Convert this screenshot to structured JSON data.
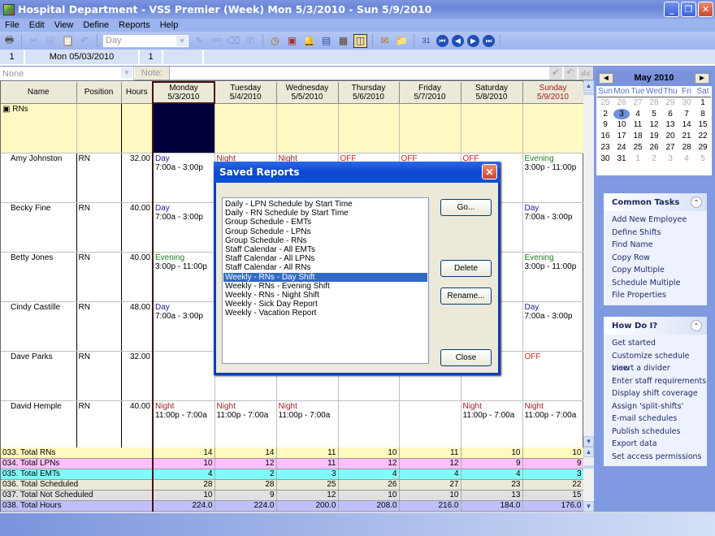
{
  "window": {
    "title": "Hospital Department - VSS Premier (Week) Mon 5/3/2010 - Sun 5/9/2010"
  },
  "menu": [
    "File",
    "Edit",
    "View",
    "Define",
    "Reports",
    "Help"
  ],
  "toolbar": {
    "shift_combo": "Day"
  },
  "infobar": {
    "cell1": "1",
    "date": "Mon  05/03/2010",
    "cell3": "1"
  },
  "notebar": {
    "combo": "None",
    "note_label": "Note:"
  },
  "grid": {
    "headers": {
      "name": "Name",
      "position": "Position",
      "hours": "Hours"
    },
    "days": [
      {
        "day": "Monday",
        "date": "5/3/2010"
      },
      {
        "day": "Tuesday",
        "date": "5/4/2010"
      },
      {
        "day": "Wednesday",
        "date": "5/5/2010"
      },
      {
        "day": "Thursday",
        "date": "5/6/2010"
      },
      {
        "day": "Friday",
        "date": "5/7/2010"
      },
      {
        "day": "Saturday",
        "date": "5/8/2010"
      },
      {
        "day": "Sunday",
        "date": "5/9/2010"
      }
    ],
    "group": "RNs",
    "employees": [
      {
        "name": "Amy Johnston",
        "position": "RN",
        "hours": "32.00",
        "shifts": [
          {
            "type": "Day",
            "time": "7:00a - 3:00p"
          },
          {
            "type": "Night",
            "time": ""
          },
          {
            "type": "Night",
            "time": ""
          },
          {
            "type": "OFF",
            "time": ""
          },
          {
            "type": "OFF",
            "time": ""
          },
          {
            "type": "OFF",
            "time": ""
          },
          {
            "type": "Evening",
            "time": "3:00p - 11:00p"
          }
        ]
      },
      {
        "name": "Becky Fine",
        "position": "RN",
        "hours": "40.00",
        "shifts": [
          {
            "type": "Day",
            "time": "7:00a - 3:00p"
          },
          {
            "type": "",
            "time": ""
          },
          {
            "type": "",
            "time": ""
          },
          {
            "type": "",
            "time": ""
          },
          {
            "type": "",
            "time": ""
          },
          {
            "type": "",
            "time": ""
          },
          {
            "type": "Day",
            "time": "7:00a - 3:00p"
          }
        ]
      },
      {
        "name": "Betty Jones",
        "position": "RN",
        "hours": "40.00",
        "shifts": [
          {
            "type": "Evening",
            "time": "3:00p - 11:00p"
          },
          {
            "type": "",
            "time": ""
          },
          {
            "type": "",
            "time": ""
          },
          {
            "type": "",
            "time": ""
          },
          {
            "type": "",
            "time": ""
          },
          {
            "type": "",
            "time": "0p"
          },
          {
            "type": "Evening",
            "time": "3:00p - 11:00p"
          }
        ]
      },
      {
        "name": "Cindy Castille",
        "position": "RN",
        "hours": "48.00",
        "shifts": [
          {
            "type": "Day",
            "time": "7:00a - 3:00p"
          },
          {
            "type": "",
            "time": ""
          },
          {
            "type": "",
            "time": ""
          },
          {
            "type": "",
            "time": ""
          },
          {
            "type": "",
            "time": ""
          },
          {
            "type": "",
            "time": "p"
          },
          {
            "type": "Day",
            "time": "7:00a - 3:00p"
          }
        ]
      },
      {
        "name": "Dave Parks",
        "position": "RN",
        "hours": "32.00",
        "shifts": [
          {
            "type": "",
            "time": ""
          },
          {
            "type": "",
            "time": ""
          },
          {
            "type": "",
            "time": ""
          },
          {
            "type": "",
            "time": ""
          },
          {
            "type": "",
            "time": ""
          },
          {
            "type": "",
            "time": ""
          },
          {
            "type": "OFF",
            "time": ""
          }
        ]
      },
      {
        "name": "David Hemple",
        "position": "RN",
        "hours": "40.00",
        "shifts": [
          {
            "type": "Night",
            "time": "11:00p - 7:00a"
          },
          {
            "type": "Night",
            "time": "11:00p - 7:00a"
          },
          {
            "type": "Night",
            "time": "11:00p - 7:00a"
          },
          {
            "type": "",
            "time": ""
          },
          {
            "type": "",
            "time": ""
          },
          {
            "type": "Night",
            "time": "11:00p - 7:00a"
          },
          {
            "type": "Night",
            "time": "11:00p - 7:00a"
          }
        ]
      }
    ],
    "totals": [
      {
        "label": "033. Total RNs",
        "color": "#fff9c0",
        "values": [
          "14",
          "14",
          "11",
          "10",
          "11",
          "10",
          "10"
        ]
      },
      {
        "label": "034. Total LPNs",
        "color": "#ffc0ff",
        "values": [
          "10",
          "12",
          "11",
          "12",
          "12",
          "9",
          "9"
        ]
      },
      {
        "label": "035. Total EMTs",
        "color": "#80ffff",
        "values": [
          "4",
          "2",
          "3",
          "4",
          "4",
          "4",
          "3"
        ]
      },
      {
        "label": "036. Total Scheduled",
        "color": "#ece9d8",
        "values": [
          "28",
          "28",
          "25",
          "26",
          "27",
          "23",
          "22"
        ]
      },
      {
        "label": "037. Total Not Scheduled",
        "color": "#e0e0e0",
        "values": [
          "10",
          "9",
          "12",
          "10",
          "10",
          "13",
          "15"
        ]
      },
      {
        "label": "038. Total Hours",
        "color": "#c0c0ff",
        "values": [
          "224.0",
          "224.0",
          "200.0",
          "208.0",
          "216.0",
          "184.0",
          "176.0"
        ]
      }
    ]
  },
  "calendar": {
    "month": "May 2010",
    "dow": [
      "Sun",
      "Mon",
      "Tue",
      "Wed",
      "Thu",
      "Fri",
      "Sat"
    ],
    "weeks": [
      [
        "25",
        "26",
        "27",
        "28",
        "29",
        "30",
        "1"
      ],
      [
        "2",
        "3",
        "4",
        "5",
        "6",
        "7",
        "8"
      ],
      [
        "9",
        "10",
        "11",
        "12",
        "13",
        "14",
        "15"
      ],
      [
        "16",
        "17",
        "18",
        "19",
        "20",
        "21",
        "22"
      ],
      [
        "23",
        "24",
        "25",
        "26",
        "27",
        "28",
        "29"
      ],
      [
        "30",
        "31",
        "1",
        "2",
        "3",
        "4",
        "5"
      ]
    ],
    "selected": "3"
  },
  "common_tasks": {
    "title": "Common Tasks",
    "items": [
      "Add New Employee",
      "Define Shifts",
      "Find Name",
      "Copy Row",
      "Copy Multiple",
      "Schedule Multiple",
      "File Properties"
    ]
  },
  "how_do_i": {
    "title": "How Do I?",
    "items": [
      "Get started",
      "Customize schedule view",
      "Insert a divider",
      "Enter staff requirements",
      "Display shift coverage",
      "Assign 'split-shifts'",
      "E-mail schedules",
      "Publish schedules",
      "Export data",
      "Set access permissions"
    ]
  },
  "dialog": {
    "title": "Saved Reports",
    "reports": [
      "Daily - LPN Schedule by Start Time",
      "Daily - RN Schedule by Start Time",
      "Group Schedule - EMTs",
      "Group Schedule - LPNs",
      "Group Schedule - RNs",
      "Staff Calendar - All EMTs",
      "Staff Calendar - All LPNs",
      "Staff Calendar - All RNs",
      "Weekly - RNs - Day Shift",
      "Weekly - RNs - Evening Shift",
      "Weekly - RNs - Night Shift",
      "Weekly - Sick Day Report",
      "Weekly - Vacation Report"
    ],
    "selected_index": 8,
    "buttons": {
      "go": "Go...",
      "delete": "Delete",
      "rename": "Rename...",
      "close": "Close"
    }
  }
}
